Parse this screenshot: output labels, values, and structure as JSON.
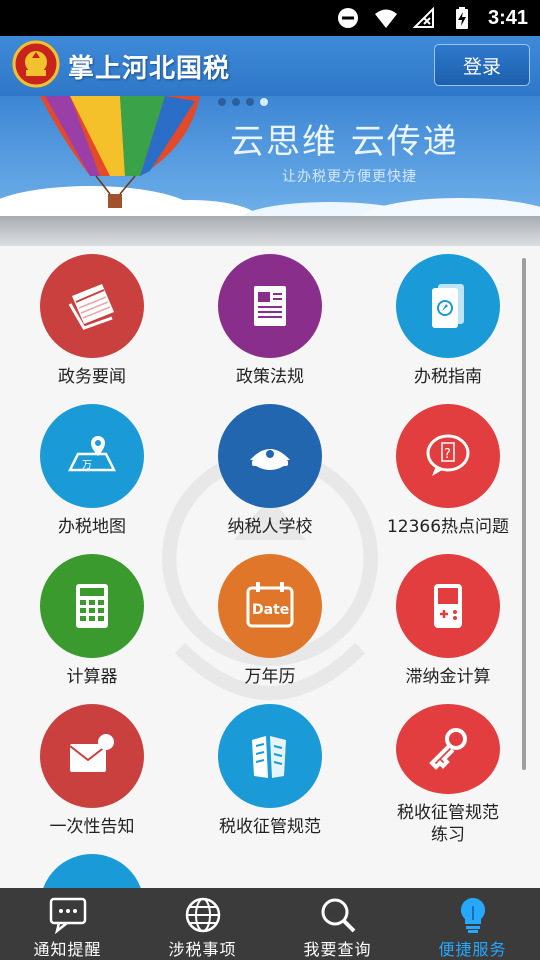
{
  "status_bar": {
    "time": "3:41"
  },
  "header": {
    "title": "掌上河北国税",
    "login_label": "登录"
  },
  "banner": {
    "slogan": "云思维 云传递",
    "sub_slogan": "让办税更方便更快捷",
    "page_count": 4,
    "active_page": 4
  },
  "grid": {
    "tiles": [
      {
        "label": "政务要闻",
        "icon": "newspaper-icon",
        "color": "#c9403e"
      },
      {
        "label": "政策法规",
        "icon": "document-icon",
        "color": "#8a2e8c"
      },
      {
        "label": "办税指南",
        "icon": "guide-book-icon",
        "color": "#1a9ad6"
      },
      {
        "label": "办税地图",
        "icon": "map-pin-icon",
        "color": "#1a9ad6"
      },
      {
        "label": "纳税人学校",
        "icon": "police-cap-icon",
        "color": "#2266b0"
      },
      {
        "label": "12366热点问题",
        "icon": "chat-question-icon",
        "color": "#e23d3f"
      },
      {
        "label": "计算器",
        "icon": "calculator-icon",
        "color": "#3b9a2d"
      },
      {
        "label": "万年历",
        "icon": "calendar-icon",
        "color": "#e0762a"
      },
      {
        "label": "滞纳金计算",
        "icon": "gamepad-icon",
        "color": "#e23d3f"
      },
      {
        "label": "一次性告知",
        "icon": "mail-notice-icon",
        "color": "#c9403e"
      },
      {
        "label": "税收征管规范",
        "icon": "building-icon",
        "color": "#1a9ad6"
      },
      {
        "label": "税收征管规范\n练习",
        "icon": "key-icon",
        "color": "#e23d3f"
      }
    ]
  },
  "bottom_nav": {
    "items": [
      {
        "label": "通知提醒",
        "icon": "message-icon"
      },
      {
        "label": "涉税事项",
        "icon": "globe-icon"
      },
      {
        "label": "我要查询",
        "icon": "search-icon"
      },
      {
        "label": "便捷服务",
        "icon": "lightbulb-icon",
        "active": true
      }
    ]
  },
  "colors": {
    "accent": "#26a8ff",
    "header_blue": "#2f77c8",
    "nav_bg": "#3b3b3b"
  }
}
